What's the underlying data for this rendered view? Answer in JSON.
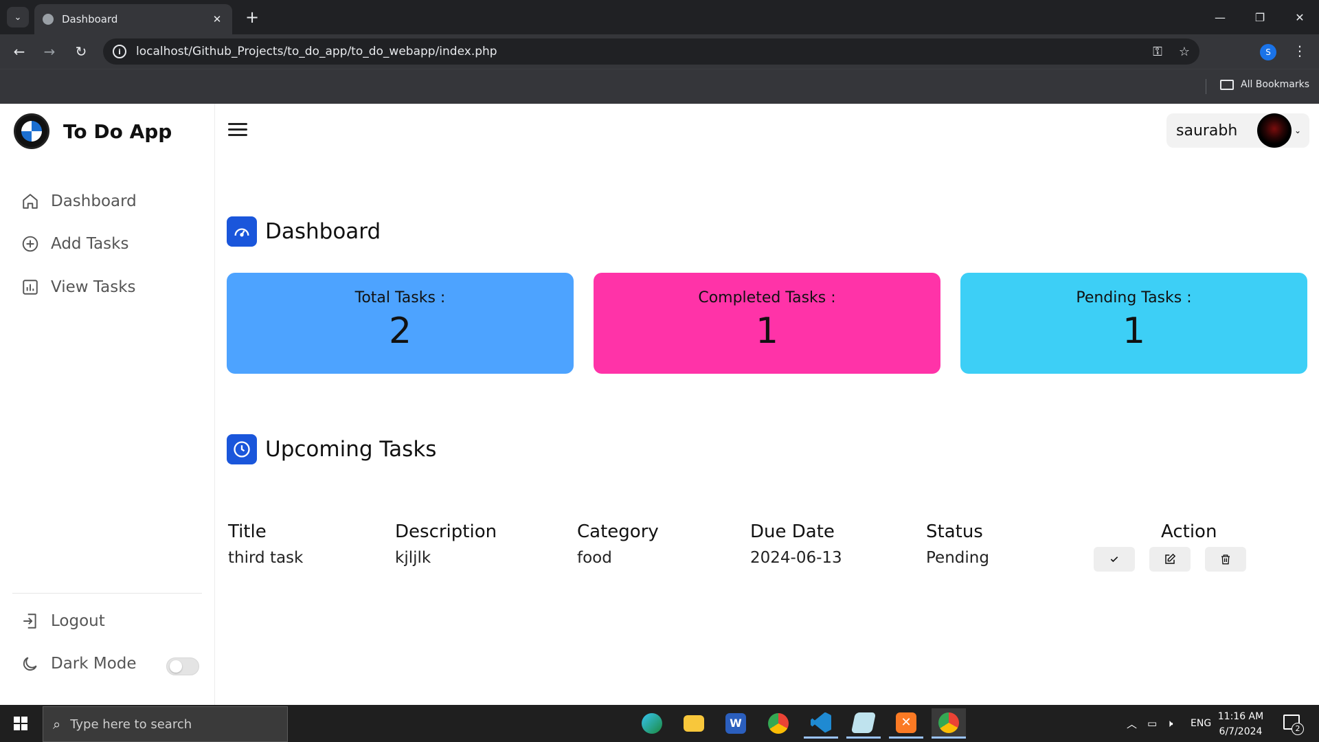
{
  "browser": {
    "tab_title": "Dashboard",
    "url": "localhost/Github_Projects/to_do_app/to_do_webapp/index.php",
    "profile_initial": "S",
    "bookmarks_label": "All Bookmarks"
  },
  "app": {
    "brand": "To Do App",
    "nav": [
      {
        "label": "Dashboard",
        "icon": "home-icon"
      },
      {
        "label": "Add Tasks",
        "icon": "plus-circle-icon"
      },
      {
        "label": "View Tasks",
        "icon": "bar-chart-icon"
      }
    ],
    "logout_label": "Logout",
    "dark_mode_label": "Dark Mode",
    "dark_mode_on": false,
    "username": "saurabh"
  },
  "dashboard": {
    "title": "Dashboard",
    "cards": [
      {
        "label": "Total Tasks :",
        "value": "2",
        "color": "#4da3ff"
      },
      {
        "label": "Completed Tasks :",
        "value": "1",
        "color": "#ff33a8"
      },
      {
        "label": "Pending Tasks :",
        "value": "1",
        "color": "#3dcff6"
      }
    ]
  },
  "upcoming": {
    "title": "Upcoming Tasks",
    "columns": [
      "Title",
      "Description",
      "Category",
      "Due Date",
      "Status",
      "Action"
    ],
    "rows": [
      {
        "title": "third task",
        "description": "kjljlk",
        "category": "food",
        "due_date": "2024-06-13",
        "status": "Pending"
      }
    ]
  },
  "taskbar": {
    "search_placeholder": "Type here to search",
    "language": "ENG",
    "time": "11:16 AM",
    "date": "6/7/2024",
    "notification_count": "2"
  },
  "colors": {
    "accent": "#1a56db",
    "sidebar_text": "#555555"
  }
}
